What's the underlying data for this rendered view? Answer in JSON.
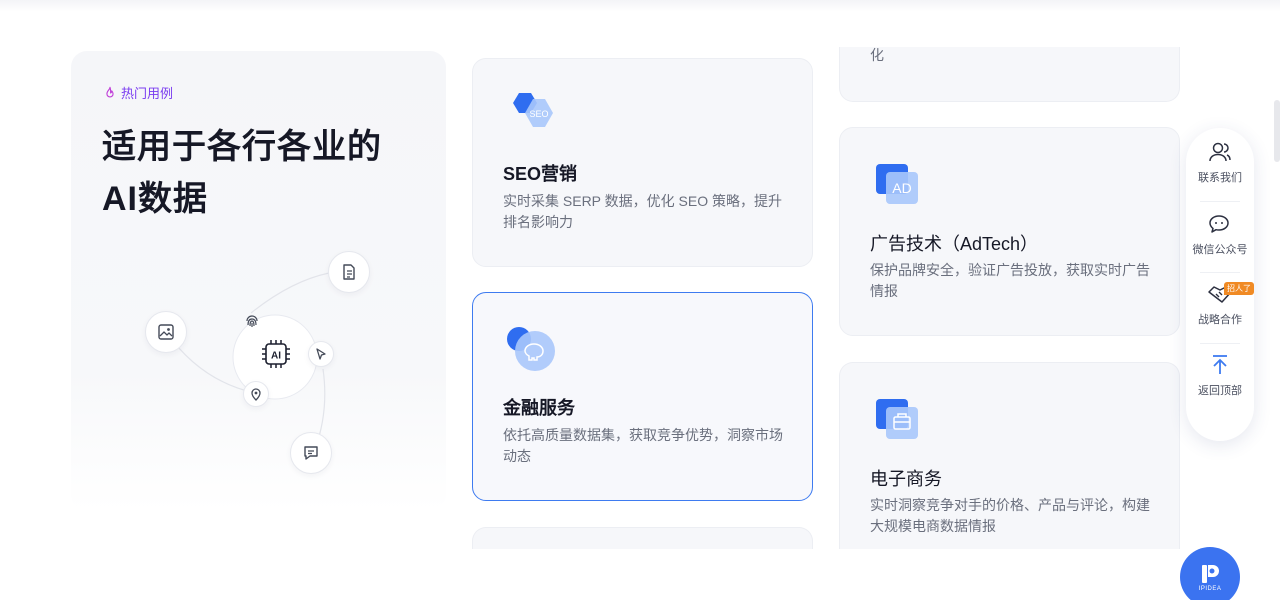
{
  "hero": {
    "tag": "热门用例",
    "title_line1": "适用于各行各业的",
    "title_line2": "AI数据",
    "center_node": "AI"
  },
  "cards": {
    "partial_top_text": "化",
    "seo": {
      "title": "SEO营销",
      "desc": "实时采集 SERP 数据，优化 SEO 策略，提升排名影响力",
      "icon_text": "SEO"
    },
    "adtech": {
      "title": "广告技术（AdTech）",
      "desc": "保护品牌安全，验证广告投放，获取实时广告情报",
      "icon_text": "AD"
    },
    "finance": {
      "title": "金融服务",
      "desc": "依托高质量数据集，获取竞争优势，洞察市场动态"
    },
    "ecommerce": {
      "title": "电子商务",
      "desc": "实时洞察竞争对手的价格、产品与评论，构建大规模电商数据情报"
    }
  },
  "float_panel": {
    "contact": "联系我们",
    "wechat": "微信公众号",
    "partner": "战略合作",
    "partner_badge": "招人了",
    "top": "返回顶部"
  },
  "brand": {
    "label": "IPIDEA"
  },
  "colors": {
    "accent": "#3e7bf0",
    "hot": "#7a3cf0",
    "brand": "#3b73f0"
  }
}
